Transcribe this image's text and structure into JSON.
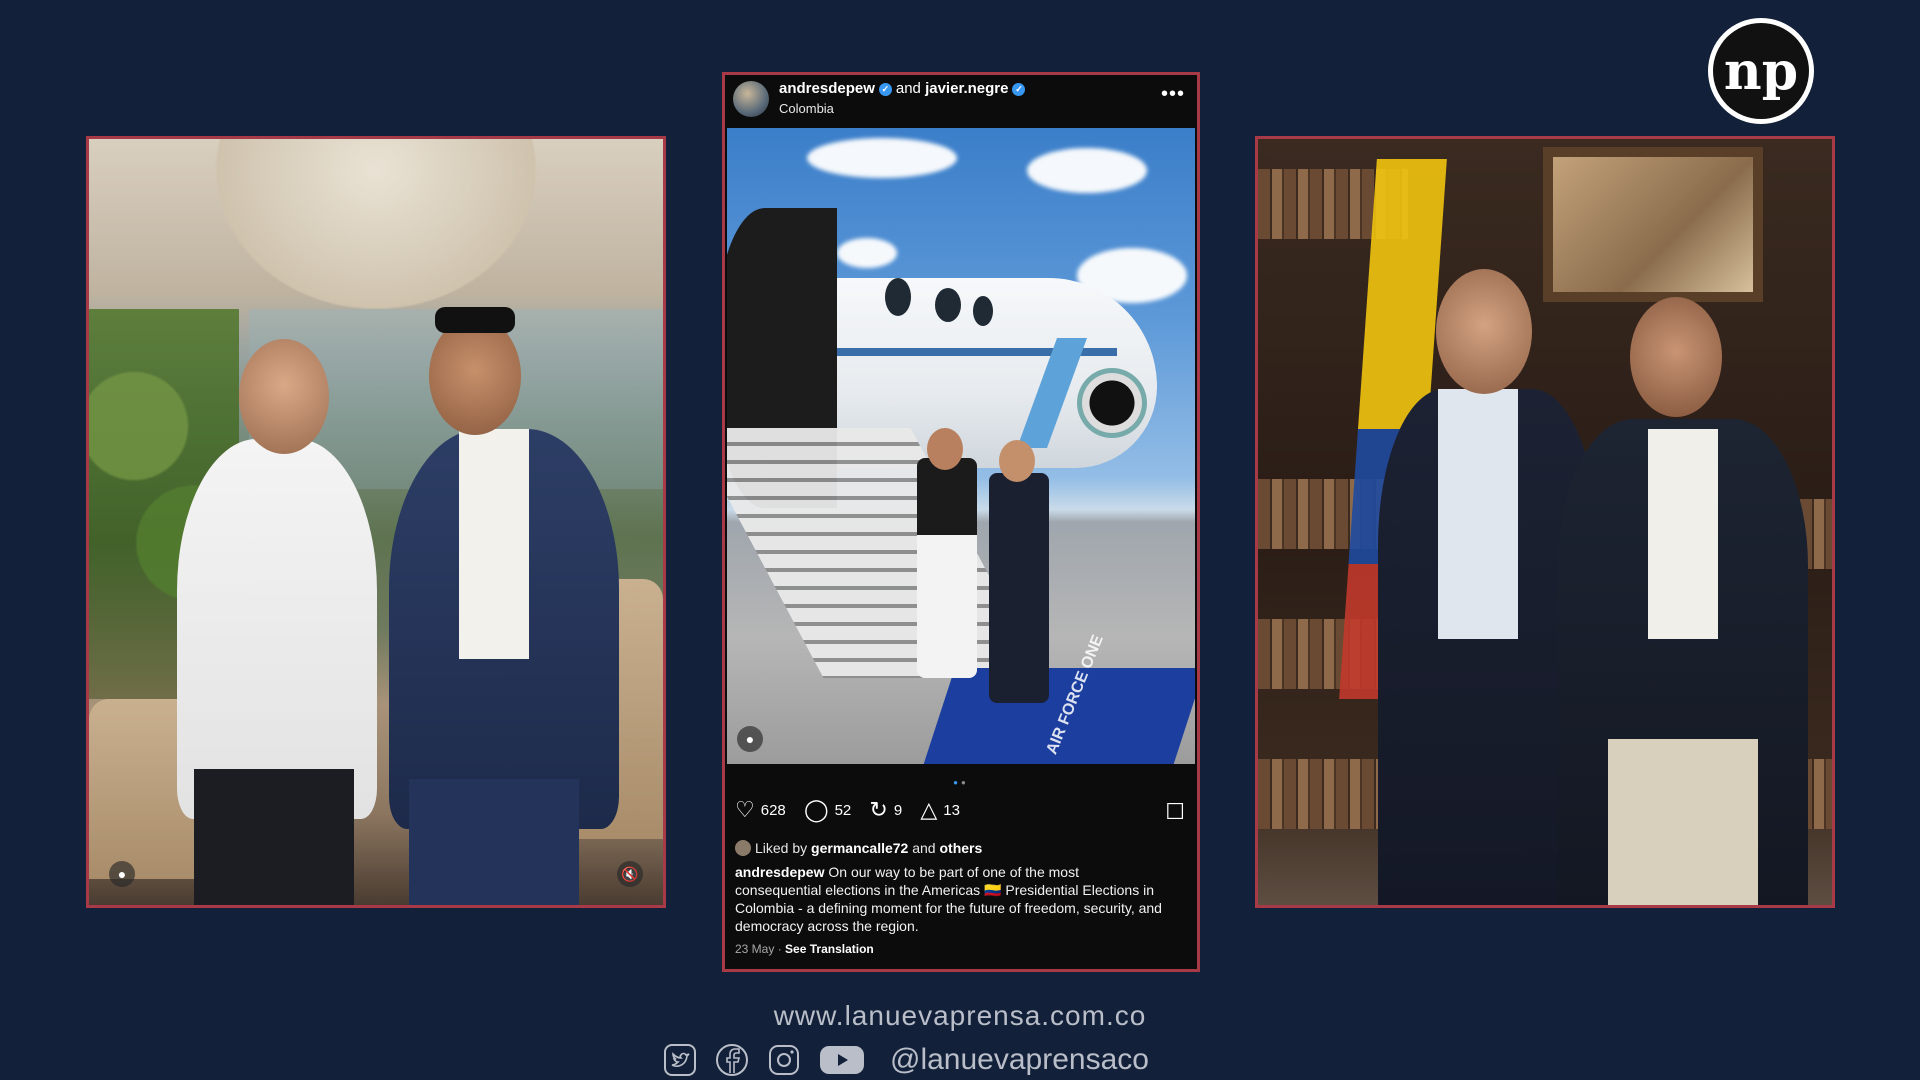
{
  "brand": {
    "logo_text": "np",
    "website": "www.lanuevaprensa.com.co",
    "social_handle": "@lanuevaprensaco",
    "social_icons": [
      "twitter-icon",
      "facebook-icon",
      "instagram-icon",
      "youtube-icon"
    ],
    "background_color": "#12203a",
    "frame_color": "#a83a47"
  },
  "post": {
    "author": "andresdepew",
    "connector": "and",
    "coauthor": "javier.negre",
    "location": "Colombia",
    "likes": "628",
    "comments": "52",
    "reposts": "9",
    "shares": "13",
    "liked_by_prefix": "Liked by",
    "liked_by_user": "germancalle72",
    "liked_by_and": "and",
    "liked_by_others": "others",
    "caption_author": "andresdepew",
    "caption_text": "On our way to be part of one of the most consequential elections in the Americas 🇨🇴 Presidential Elections in Colombia - a defining moment for the future of freedom, security, and democracy across the region.",
    "date": "23 May",
    "separator": "·",
    "see_translation": "See Translation",
    "carpet_text": "AIR FORCE ONE"
  }
}
